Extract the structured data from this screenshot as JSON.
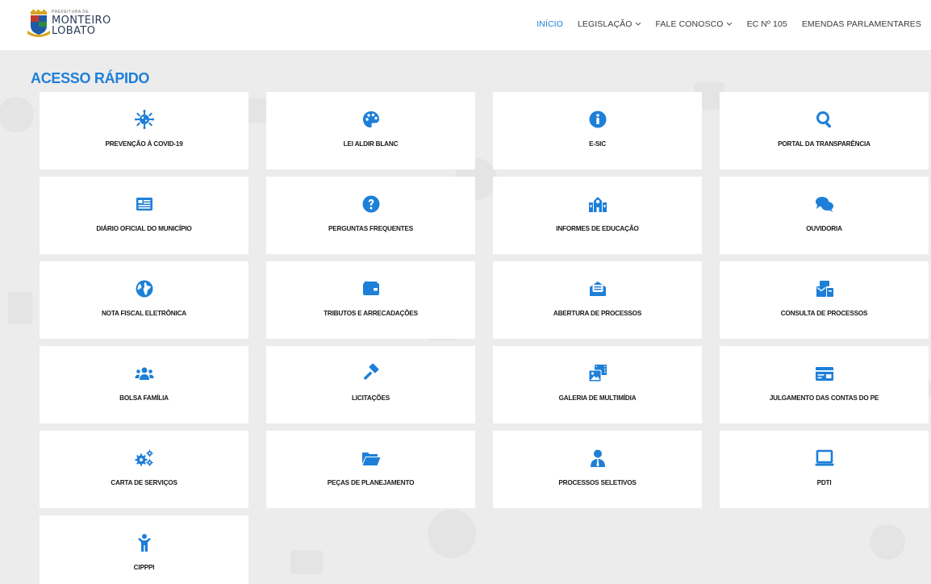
{
  "header": {
    "logo": {
      "small_text": "PREFEITURA DE",
      "line1": "MONTEIRO",
      "line2": "LOBATO"
    },
    "nav": [
      {
        "label": "INÍCIO",
        "active": true,
        "dropdown": false
      },
      {
        "label": "LEGISLAÇÃO",
        "active": false,
        "dropdown": true
      },
      {
        "label": "FALE CONOSCO",
        "active": false,
        "dropdown": true
      },
      {
        "label": "EC Nº 105",
        "active": false,
        "dropdown": false
      },
      {
        "label": "EMENDAS PARLAMENTARES",
        "active": false,
        "dropdown": false
      }
    ]
  },
  "main": {
    "section_title": "ACESSO RÁPIDO",
    "accent_color": "#1e7fd8",
    "cards": [
      {
        "label": "PREVENÇÃO À COVID-19",
        "icon": "virus-icon"
      },
      {
        "label": "LEI ALDIR BLANC",
        "icon": "palette-icon"
      },
      {
        "label": "E-SIC",
        "icon": "info-icon"
      },
      {
        "label": "PORTAL DA TRANSPARÊNCIA",
        "icon": "search-icon"
      },
      {
        "label": "DIÁRIO OFICIAL DO MUNICÍPIO",
        "icon": "newspaper-icon"
      },
      {
        "label": "PERGUNTAS FREQUENTES",
        "icon": "question-icon"
      },
      {
        "label": "INFORMES DE EDUCAÇÃO",
        "icon": "school-icon"
      },
      {
        "label": "OUVIDORIA",
        "icon": "comments-icon"
      },
      {
        "label": "NOTA FISCAL ELETRÔNICA",
        "icon": "globe-icon"
      },
      {
        "label": "TRIBUTOS E ARRECADAÇÕES",
        "icon": "wallet-icon"
      },
      {
        "label": "ABERTURA DE PROCESSOS",
        "icon": "envelope-open-icon"
      },
      {
        "label": "CONSULTA DE PROCESSOS",
        "icon": "mail-bulk-icon"
      },
      {
        "label": "BOLSA FAMÍLIA",
        "icon": "users-icon"
      },
      {
        "label": "LICITAÇÕES",
        "icon": "gavel-icon"
      },
      {
        "label": "GALERIA DE MULTIMÍDIA",
        "icon": "photo-video-icon"
      },
      {
        "label": "JULGAMENTO DAS CONTAS DO PE",
        "icon": "money-check-icon"
      },
      {
        "label": "CARTA DE SERVIÇOS",
        "icon": "cogs-icon"
      },
      {
        "label": "PEÇAS DE PLANEJAMENTO",
        "icon": "folder-open-icon"
      },
      {
        "label": "PROCESSOS SELETIVOS",
        "icon": "user-tie-icon"
      },
      {
        "label": "PDTI",
        "icon": "laptop-icon"
      },
      {
        "label": "CIPPPI",
        "icon": "child-icon"
      }
    ]
  }
}
